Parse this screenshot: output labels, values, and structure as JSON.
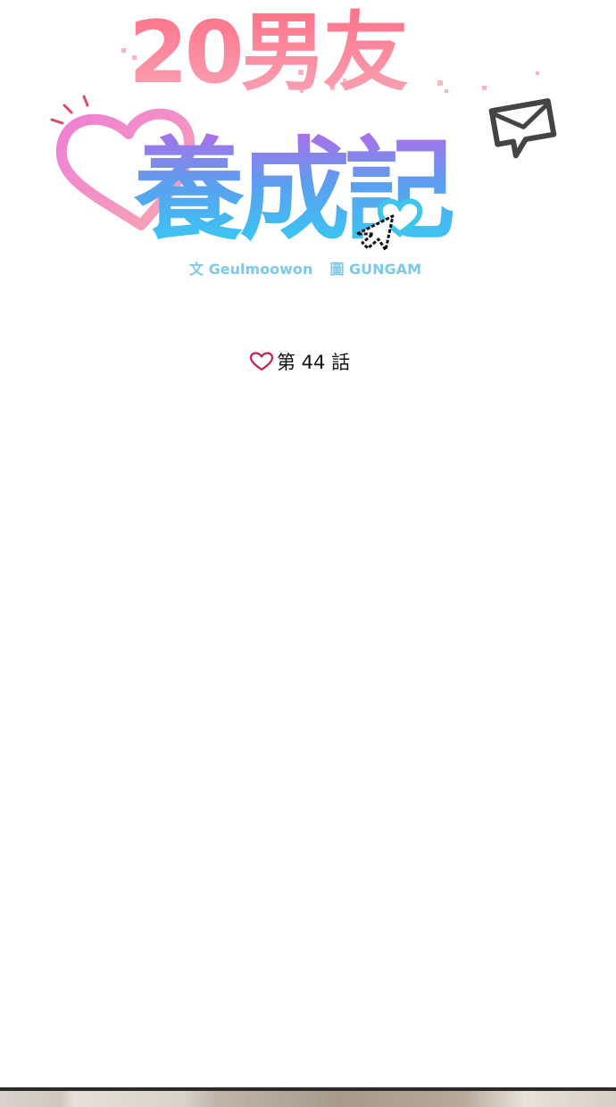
{
  "title": {
    "line1": "20男友",
    "line2": "養成記"
  },
  "credits": {
    "writer_label": "文",
    "writer_name": "Geulmoowon",
    "artist_label": "圖",
    "artist_name": "GUNGAM"
  },
  "episode": {
    "icon": "heart-outline-icon",
    "label": "第 44 話"
  },
  "colors": {
    "title_pink": "#f06d86",
    "title_blue": "#4fc9ef",
    "title_purple": "#9a73e6",
    "heart_outline": "#c0264d",
    "credits": "#7fc8e8"
  }
}
